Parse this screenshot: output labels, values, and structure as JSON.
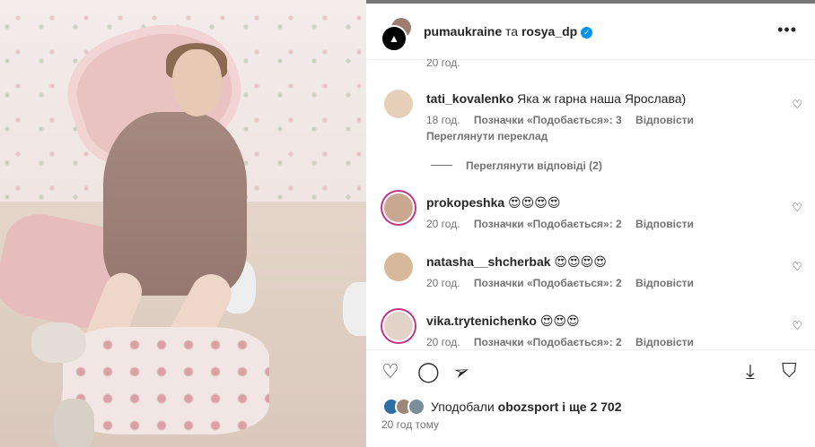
{
  "post": {
    "account": "pumaukraine",
    "connector": "та",
    "collaborator": "rosya_dp",
    "more_icon": "more-horizontal-icon"
  },
  "comments": {
    "top_time": "20 год.",
    "items": [
      {
        "username": "tati_kovalenko",
        "text": "Яка ж гарна наша Ярослава)",
        "time": "18 год.",
        "likes": "Позначки «Подобається»: 3",
        "reply": "Відповісти",
        "translate": "Переглянути переклад"
      },
      {
        "username": "prokopeshka",
        "text": "😍😍😍😍",
        "time": "20 год.",
        "likes": "Позначки «Подобається»: 2",
        "reply": "Відповісти"
      },
      {
        "username": "natasha__shcherbak",
        "text": "😍😍😍😍",
        "time": "20 год.",
        "likes": "Позначки «Подобається»: 2",
        "reply": "Відповісти"
      },
      {
        "username": "vika.trytenichenko",
        "text": "😍😍😍",
        "time": "20 год.",
        "likes": "Позначки «Подобається»: 2",
        "reply": "Відповісти"
      }
    ],
    "view_replies": "Переглянути відповіді (2)"
  },
  "likes": {
    "prefix": "Уподобали",
    "user": "obozsport",
    "suffix": "і ще 2 702"
  },
  "date": "20 год тому",
  "colors": {
    "accent": "#0095f6",
    "story_ring": "#c13584",
    "muted": "#737373"
  }
}
